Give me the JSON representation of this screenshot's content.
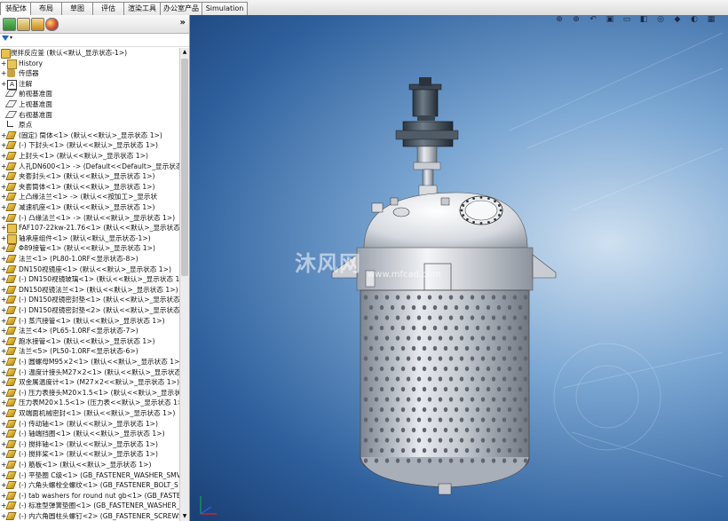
{
  "ribbon": {
    "tabs": [
      {
        "label": "装配体",
        "active": true
      },
      {
        "label": "布局"
      },
      {
        "label": "草图"
      },
      {
        "label": "评估"
      },
      {
        "label": "渲染工具"
      },
      {
        "label": "办公室产品"
      },
      {
        "label": "Simulation"
      }
    ]
  },
  "panel": {
    "expand_glyph": "»",
    "root": "搅拌反应釜  (默认<默认_显示状态-1>)",
    "items": [
      {
        "icon": "folder",
        "label": "History"
      },
      {
        "icon": "sensor",
        "label": "传感器"
      },
      {
        "icon": "annotation",
        "label": "注解"
      },
      {
        "icon": "plane",
        "label": "前视基准面"
      },
      {
        "icon": "plane",
        "label": "上视基准面"
      },
      {
        "icon": "plane",
        "label": "右视基准面"
      },
      {
        "icon": "origin",
        "label": "原点"
      },
      {
        "icon": "part",
        "label": "(固定) 筒体<1> (默认<<默认>_显示状态 1>)"
      },
      {
        "icon": "part",
        "label": "(-) 下封头<1> (默认<<默认>_显示状态 1>)"
      },
      {
        "icon": "part",
        "label": "上封头<1> (默认<<默认>_显示状态 1>)"
      },
      {
        "icon": "part",
        "label": "人孔DN600<1> -> (Default<<Default>_显示状态"
      },
      {
        "icon": "part",
        "label": "夹套封头<1> (默认<<默认>_显示状态 1>)"
      },
      {
        "icon": "part",
        "label": "夹套筒体<1> (默认<<默认>_显示状态 1>)"
      },
      {
        "icon": "part",
        "label": "上凸缘法兰<1> -> (默认<<按加工>_显示状"
      },
      {
        "icon": "part",
        "label": "减速机座<1> (默认<<默认>_显示状态 1>)"
      },
      {
        "icon": "part",
        "label": "(-) 凸缘法兰<1> -> (默认<<默认>_显示状态 1>)"
      },
      {
        "icon": "assembly",
        "label": "FAF107-22kw-21.76<1> (默认<<默认>_显示状态"
      },
      {
        "icon": "assembly",
        "label": "轴承座组件<1> (默认<默认_显示状态-1>)"
      },
      {
        "icon": "part",
        "label": "Φ89接管<1> (默认<<默认>_显示状态 1>)"
      },
      {
        "icon": "part",
        "label": "法兰<1> (PL80-1.0RF<显示状态-8>)"
      },
      {
        "icon": "part",
        "label": "DN150视镜座<1> (默认<<默认>_显示状态 1>)"
      },
      {
        "icon": "part",
        "label": "(-) DN150视镜玻璃<1> (默认<<默认>_显示状态 1"
      },
      {
        "icon": "part",
        "label": "DN150视镜法兰<1> (默认<<默认>_显示状态 1>)"
      },
      {
        "icon": "part",
        "label": "(-) DN150视镜密封垫<1> (默认<<默认>_显示状态"
      },
      {
        "icon": "part",
        "label": "(-) DN150视镜密封垫<2> (默认<<默认>_显示状态"
      },
      {
        "icon": "part",
        "label": "(-) 蒸汽接管<1> (默认<<默认>_显示状态 1>)"
      },
      {
        "icon": "part",
        "label": "法兰<4> (PL65-1.0RF<显示状态-7>)"
      },
      {
        "icon": "part",
        "label": "跑水接管<1> (默认<<默认>_显示状态 1>)"
      },
      {
        "icon": "part",
        "label": "法兰<5> (PL50-1.0RF<显示状态-6>)"
      },
      {
        "icon": "part",
        "label": "(-) 圆螺母M95×2<1> (默认<<默认>_显示状态 1>)"
      },
      {
        "icon": "part",
        "label": "(-) 温度计接头M27×2<1> (默认<<默认>_显示状态"
      },
      {
        "icon": "part",
        "label": "双金属温度计<1> (M27×2<<默认>_显示状态 1>)"
      },
      {
        "icon": "part",
        "label": "(-) 压力表接头M20×1.5<1> (默认<<默认>_显示状"
      },
      {
        "icon": "part",
        "label": "压力表M20×1.5<1> (压力表<<默认>_显示状态 1>)"
      },
      {
        "icon": "part",
        "label": "双端面机械密封<1> (默认<<默认>_显示状态 1>)"
      },
      {
        "icon": "part",
        "label": "(-) 传动轴<1> (默认<<默认>_显示状态 1>)"
      },
      {
        "icon": "part",
        "label": "(-) 轴端挡圈<1> (默认<<默认>_显示状态 1>)"
      },
      {
        "icon": "part",
        "label": "(-) 搅拌轴<1> (默认<<默认>_显示状态 1>)"
      },
      {
        "icon": "part",
        "label": "(-) 搅拌桨<1> (默认<<默认>_显示状态 1>)"
      },
      {
        "icon": "part",
        "label": "(-) 筋板<1> (默认<<默认>_显示状态 1>)"
      },
      {
        "icon": "part",
        "label": "(-) 平垫圈 C级<1> (GB_FASTENER_WASHER_SMV"
      },
      {
        "icon": "part",
        "label": "(-) 六角头螺栓全螺纹<1> (GB_FASTENER_BOLT_S"
      },
      {
        "icon": "part",
        "label": "(-) tab washers for round nut gb<1> (GB_FASTE"
      },
      {
        "icon": "part",
        "label": "(-) 标准型弹簧垫圈<1> (GB_FASTENER_WASHER_S"
      },
      {
        "icon": "part",
        "label": "(-) 内六角圆柱头螺钉<2> (GB_FASTENER_SCREWS"
      }
    ]
  },
  "viewport": {
    "hud_icons": [
      "zoom-to-fit-icon",
      "zoom-area-icon",
      "previous-view-icon",
      "section-view-icon",
      "view-orientation-icon",
      "display-style-icon",
      "hide-show-icon",
      "appearance-icon",
      "scene-icon",
      "view-settings-icon"
    ],
    "watermark_brand": "沐风网",
    "watermark_url": "www.mfcad.com"
  },
  "colors": {
    "viewport_bg": "#2e5f9c",
    "vessel_steel": "#c9ccd2",
    "dimple": "#5f6670"
  }
}
